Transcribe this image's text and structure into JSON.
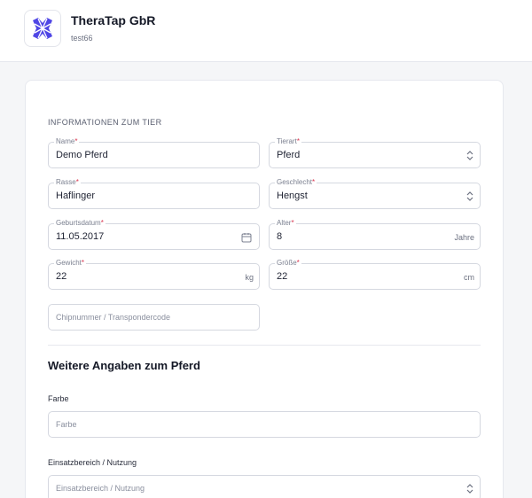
{
  "header": {
    "company_name": "TheraTap GbR",
    "company_sub": "test66"
  },
  "section": {
    "title": "INFORMATIONEN ZUM TIER"
  },
  "fields": {
    "name": {
      "label": "Name",
      "value": "Demo Pferd",
      "required": true
    },
    "tierart": {
      "label": "Tierart",
      "value": "Pferd",
      "required": true
    },
    "rasse": {
      "label": "Rasse",
      "value": "Haflinger",
      "required": true
    },
    "geschlecht": {
      "label": "Geschlecht",
      "value": "Hengst",
      "required": true
    },
    "geburtsdatum": {
      "label": "Geburtsdatum",
      "value": "11.05.2017",
      "required": true
    },
    "alter": {
      "label": "Alter",
      "value": "8",
      "unit": "Jahre",
      "required": true
    },
    "gewicht": {
      "label": "Gewicht",
      "value": "22",
      "unit": "kg",
      "required": true
    },
    "groesse": {
      "label": "Größe",
      "value": "22",
      "unit": "cm",
      "required": true
    },
    "chip": {
      "placeholder": "Chipnummer / Transpondercode"
    }
  },
  "more": {
    "heading": "Weitere Angaben zum Pferd",
    "farbe_label": "Farbe",
    "farbe_placeholder": "Farbe",
    "einsatz_label": "Einsatzbereich / Nutzung",
    "einsatz_placeholder": "Einsatzbereich / Nutzung"
  },
  "required_mark": "*",
  "icons": {
    "logo": "theratap-logo-icon",
    "select": "chevron-up-down-icon",
    "date": "calendar-icon"
  },
  "colors": {
    "brand": "#4f46e5",
    "required": "#d9344f"
  }
}
